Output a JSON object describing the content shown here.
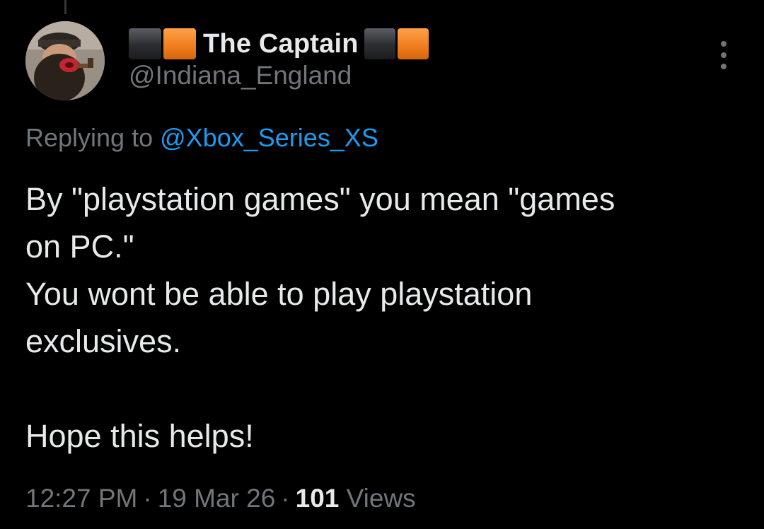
{
  "author": {
    "display_name": "The Captain",
    "handle": "@Indiana_England",
    "name_prefix_icon": "dark-orange-squares-icon",
    "name_suffix_icon": "dark-orange-squares-icon"
  },
  "reply": {
    "prefix": "Replying to",
    "mention": "@Xbox_Series_XS"
  },
  "tweet": {
    "lines": [
      "By \"playstation games\" you mean \"games",
      "on PC.\"",
      "You wont be able to play playstation",
      "exclusives.",
      "",
      "Hope this helps!"
    ]
  },
  "meta": {
    "time": "12:27 PM",
    "date": "19 Mar 26",
    "separator": "·",
    "views_count": "101",
    "views_label": "Views"
  },
  "icons": {
    "more": "more-options-icon"
  },
  "colors": {
    "background": "#000000",
    "text_primary": "#e7e9ea",
    "text_secondary": "#71767b",
    "link": "#1d9bf0",
    "accent_orange": "#f07c1c"
  }
}
